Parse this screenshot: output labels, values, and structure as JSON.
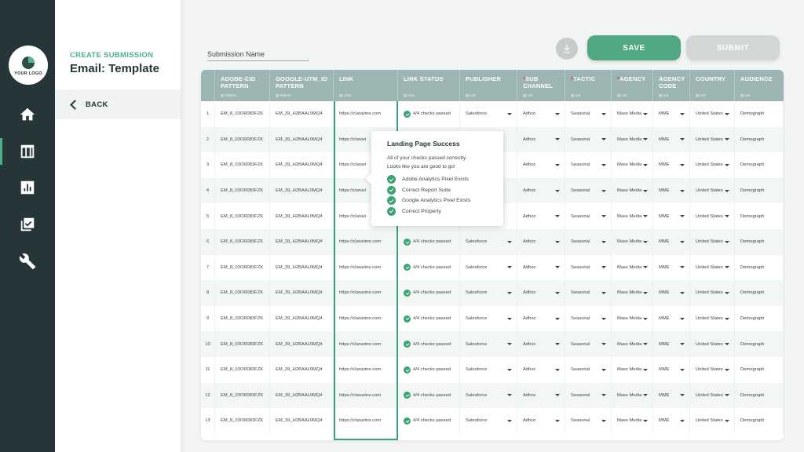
{
  "logo": {
    "text": "YOUR LOGO"
  },
  "rail": {
    "items": [
      {
        "icon": "home-icon",
        "active": false
      },
      {
        "icon": "table-icon",
        "active": true
      },
      {
        "icon": "chart-icon",
        "active": false
      },
      {
        "icon": "checklist-icon",
        "active": false
      },
      {
        "icon": "wrench-icon",
        "active": false
      }
    ]
  },
  "panel": {
    "eyebrow": "CREATE SUBMISSION",
    "title": "Email: Template",
    "back_label": "BACK"
  },
  "header": {
    "submission_name_placeholder": "Submission Name",
    "save_label": "SAVE",
    "submit_label": "SUBMIT"
  },
  "colors": {
    "accent": "#4fa882",
    "rail": "#263638",
    "header": "#9db6b4",
    "required": "#d8352b"
  },
  "table": {
    "columns": [
      {
        "label": "ADOBE-CID PATTERN",
        "sub": "Pattern",
        "required": false
      },
      {
        "label": "GOOGLE-UTM_ID PATTERN",
        "sub": "Pattern",
        "required": false
      },
      {
        "label": "LINK",
        "sub": "LINK",
        "required": false
      },
      {
        "label": "LINK STATUS",
        "sub": "Link",
        "required": false
      },
      {
        "label": "PUBLISHER",
        "sub": "List",
        "required": false
      },
      {
        "label": "SUB CHANNEL",
        "sub": "List",
        "required": true
      },
      {
        "label": "TACTIC",
        "sub": "List",
        "required": true
      },
      {
        "label": "AGENCY",
        "sub": "List",
        "required": true
      },
      {
        "label": "AGENCY CODE",
        "sub": "List",
        "required": false
      },
      {
        "label": "COUNTRY",
        "sub": "List",
        "required": false
      },
      {
        "label": "AUDIENCE",
        "sub": "List",
        "required": false
      }
    ],
    "rows": [
      {
        "n": "1",
        "adobe": "EM_8_03OR083FZK",
        "google": "EM_39_H2BAAL0MQ4",
        "link": "https://claravine.com",
        "status": "4/4 checks passed",
        "publisher": "Salesforce",
        "sub_channel": "Adhoc",
        "tactic": "Seasonal",
        "agency": "Mass Media",
        "agency_code": "MME",
        "country": "United States",
        "audience": "Demograph"
      },
      {
        "n": "2",
        "adobe": "EM_8_03OR083FZK",
        "google": "EM_39_H2BAAL0MQ4",
        "link": "https://claravi",
        "status": "",
        "publisher": "",
        "sub_channel": "Adhoc",
        "tactic": "Seasonal",
        "agency": "Mass Media",
        "agency_code": "MME",
        "country": "United States",
        "audience": "Demograph"
      },
      {
        "n": "3",
        "adobe": "EM_8_03OR083FZK",
        "google": "EM_39_H2BAAL0MQ4",
        "link": "https://claravi",
        "status": "",
        "publisher": "",
        "sub_channel": "Adhoc",
        "tactic": "Seasonal",
        "agency": "Mass Media",
        "agency_code": "MME",
        "country": "United States",
        "audience": "Demograph"
      },
      {
        "n": "4",
        "adobe": "EM_8_03OR083FZK",
        "google": "EM_39_H2BAAL0MQ4",
        "link": "https://claravi",
        "status": "",
        "publisher": "",
        "sub_channel": "Adhoc",
        "tactic": "Seasonal",
        "agency": "Mass Media",
        "agency_code": "MME",
        "country": "United States",
        "audience": "Demograph"
      },
      {
        "n": "5",
        "adobe": "EM_8_03OR083FZK",
        "google": "EM_39_H2BAAL0MQ4",
        "link": "https://claravi",
        "status": "",
        "publisher": "",
        "sub_channel": "Adhoc",
        "tactic": "Seasonal",
        "agency": "Mass Media",
        "agency_code": "MME",
        "country": "United States",
        "audience": "Demograph"
      },
      {
        "n": "6",
        "adobe": "EM_8_03OR083FZK",
        "google": "EM_39_H2BAAL0MQ4",
        "link": "https://claravine.com",
        "status": "4/4 checks passed",
        "publisher": "Salesforce",
        "sub_channel": "Adhoc",
        "tactic": "Seasonal",
        "agency": "Mass Media",
        "agency_code": "MME",
        "country": "United States",
        "audience": "Demograph"
      },
      {
        "n": "7",
        "adobe": "EM_8_03OR083FZK",
        "google": "EM_39_H2BAAL0MQ4",
        "link": "https://claravine.com",
        "status": "4/4 checks passed",
        "publisher": "Salesforce",
        "sub_channel": "Adhoc",
        "tactic": "Seasonal",
        "agency": "Mass Media",
        "agency_code": "MME",
        "country": "United States",
        "audience": "Demograph"
      },
      {
        "n": "8",
        "adobe": "EM_8_03OR083FZK",
        "google": "EM_39_H2BAAL0MQ4",
        "link": "https://claravine.com",
        "status": "4/4 checks passed",
        "publisher": "Salesforce",
        "sub_channel": "Adhoc",
        "tactic": "Seasonal",
        "agency": "Mass Media",
        "agency_code": "MME",
        "country": "United States",
        "audience": "Demograph"
      },
      {
        "n": "9",
        "adobe": "EM_8_03OR083FZK",
        "google": "EM_39_H2BAAL0MQ4",
        "link": "https://claravine.com",
        "status": "4/4 checks passed",
        "publisher": "Salesforce",
        "sub_channel": "Adhoc",
        "tactic": "Seasonal",
        "agency": "Mass Media",
        "agency_code": "MME",
        "country": "United States",
        "audience": "Demograph"
      },
      {
        "n": "10",
        "adobe": "EM_8_03OR083FZK",
        "google": "EM_39_H2BAAL0MQ4",
        "link": "https://claravine.com",
        "status": "4/4 checks passed",
        "publisher": "Salesforce",
        "sub_channel": "Adhoc",
        "tactic": "Seasonal",
        "agency": "Mass Media",
        "agency_code": "MME",
        "country": "United States",
        "audience": "Demograph"
      },
      {
        "n": "11",
        "adobe": "EM_8_03OR083FZK",
        "google": "EM_39_H2BAAL0MQ4",
        "link": "https://claravine.com",
        "status": "4/4 checks passed",
        "publisher": "Salesforce",
        "sub_channel": "Adhoc",
        "tactic": "Seasonal",
        "agency": "Mass Media",
        "agency_code": "MME",
        "country": "United States",
        "audience": "Demograph"
      },
      {
        "n": "12",
        "adobe": "EM_8_03OR083FZK",
        "google": "EM_39_H2BAAL0MQ4",
        "link": "https://claravine.com",
        "status": "4/4 checks passed",
        "publisher": "Salesforce",
        "sub_channel": "Adhoc",
        "tactic": "Seasonal",
        "agency": "Mass Media",
        "agency_code": "MME",
        "country": "United States",
        "audience": "Demograph"
      },
      {
        "n": "13",
        "adobe": "EM_8_03OR083FZK",
        "google": "EM_39_H2BAAL0MQ4",
        "link": "https://claravine.com",
        "status": "4/4 checks passed",
        "publisher": "Salesforce",
        "sub_channel": "Adhoc",
        "tactic": "Seasonal",
        "agency": "Mass Media",
        "agency_code": "MME",
        "country": "United States",
        "audience": "Demograph"
      }
    ]
  },
  "popover": {
    "title": "Landing Page Success",
    "line1": "All of your checks passed correctly.",
    "line2": "Looks like you are good to go!",
    "checks": [
      "Adobe Analytics Pixel Exists",
      "Correct Report Suite",
      "Google Analytics Pixel Exists",
      "Correct Property"
    ]
  }
}
